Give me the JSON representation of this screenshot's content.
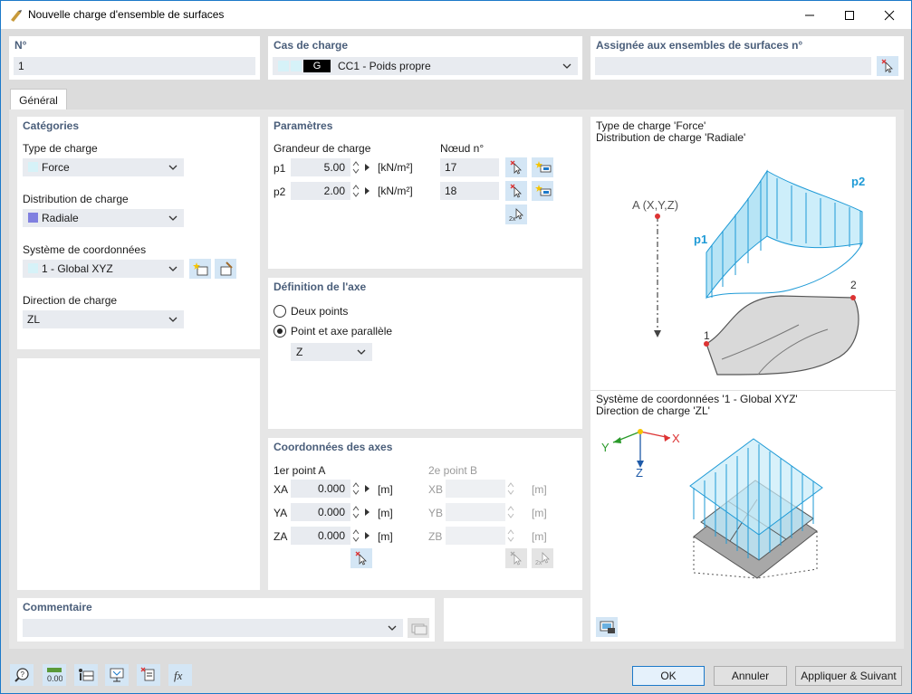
{
  "window": {
    "title": "Nouvelle charge d'ensemble de surfaces"
  },
  "header": {
    "no_label": "N°",
    "no_value": "1",
    "load_case_label": "Cas de charge",
    "load_case_code": "G",
    "load_case_value": "CC1 - Poids propre",
    "assigned_label": "Assignée aux ensembles de surfaces n°",
    "assigned_value": ""
  },
  "tabs": [
    {
      "label": "Général"
    }
  ],
  "categories": {
    "title": "Catégories",
    "load_type_label": "Type de charge",
    "load_type_value": "Force",
    "load_type_color": "#d6f2f8",
    "distribution_label": "Distribution de charge",
    "distribution_value": "Radiale",
    "distribution_color": "#8080e0",
    "coord_label": "Système de coordonnées",
    "coord_value": "1 - Global XYZ",
    "coord_color": "#d6f2f8",
    "direction_label": "Direction de charge",
    "direction_value": "ZL"
  },
  "parameters": {
    "title": "Paramètres",
    "magnitude_label": "Grandeur de charge",
    "node_label": "Nœud n°",
    "rows": [
      {
        "label": "p1",
        "value": "5.00",
        "unit": "[kN/m²]",
        "node": "17"
      },
      {
        "label": "p2",
        "value": "2.00",
        "unit": "[kN/m²]",
        "node": "18"
      }
    ]
  },
  "axis_definition": {
    "title": "Définition de l'axe",
    "options": [
      "Deux points",
      "Point et axe parallèle"
    ],
    "selected": "Point et axe parallèle",
    "axis_value": "Z"
  },
  "axis_coords": {
    "title": "Coordonnées des axes",
    "point_a_label": "1er point A",
    "point_b_label": "2e point B",
    "a_rows": [
      {
        "label": "XA",
        "value": "0.000",
        "unit": "[m]"
      },
      {
        "label": "YA",
        "value": "0.000",
        "unit": "[m]"
      },
      {
        "label": "ZA",
        "value": "0.000",
        "unit": "[m]"
      }
    ],
    "b_rows": [
      {
        "label": "XB",
        "unit": "[m]"
      },
      {
        "label": "YB",
        "unit": "[m]"
      },
      {
        "label": "ZB",
        "unit": "[m]"
      }
    ]
  },
  "comment": {
    "title": "Commentaire",
    "value": ""
  },
  "preview": {
    "top_line1": "Type de charge 'Force'",
    "top_line2": "Distribution de charge 'Radiale'",
    "bottom_line1": "Système de coordonnées '1 - Global XYZ'",
    "bottom_line2": "Direction de charge 'ZL'",
    "axis_point_label": "A (X,Y,Z)",
    "p1_label": "p1",
    "p2_label": "p2",
    "node1_label": "1",
    "node2_label": "2",
    "x_label": "X",
    "y_label": "Y",
    "z_label": "Z"
  },
  "buttons": {
    "ok": "OK",
    "cancel": "Annuler",
    "apply_next": "Appliquer & Suivant"
  },
  "colors": {
    "accent": "#1c79c9",
    "section_title": "#4a5e7a",
    "load_blue": "#1e9ad6",
    "icon_bg": "#d4e6f5"
  }
}
